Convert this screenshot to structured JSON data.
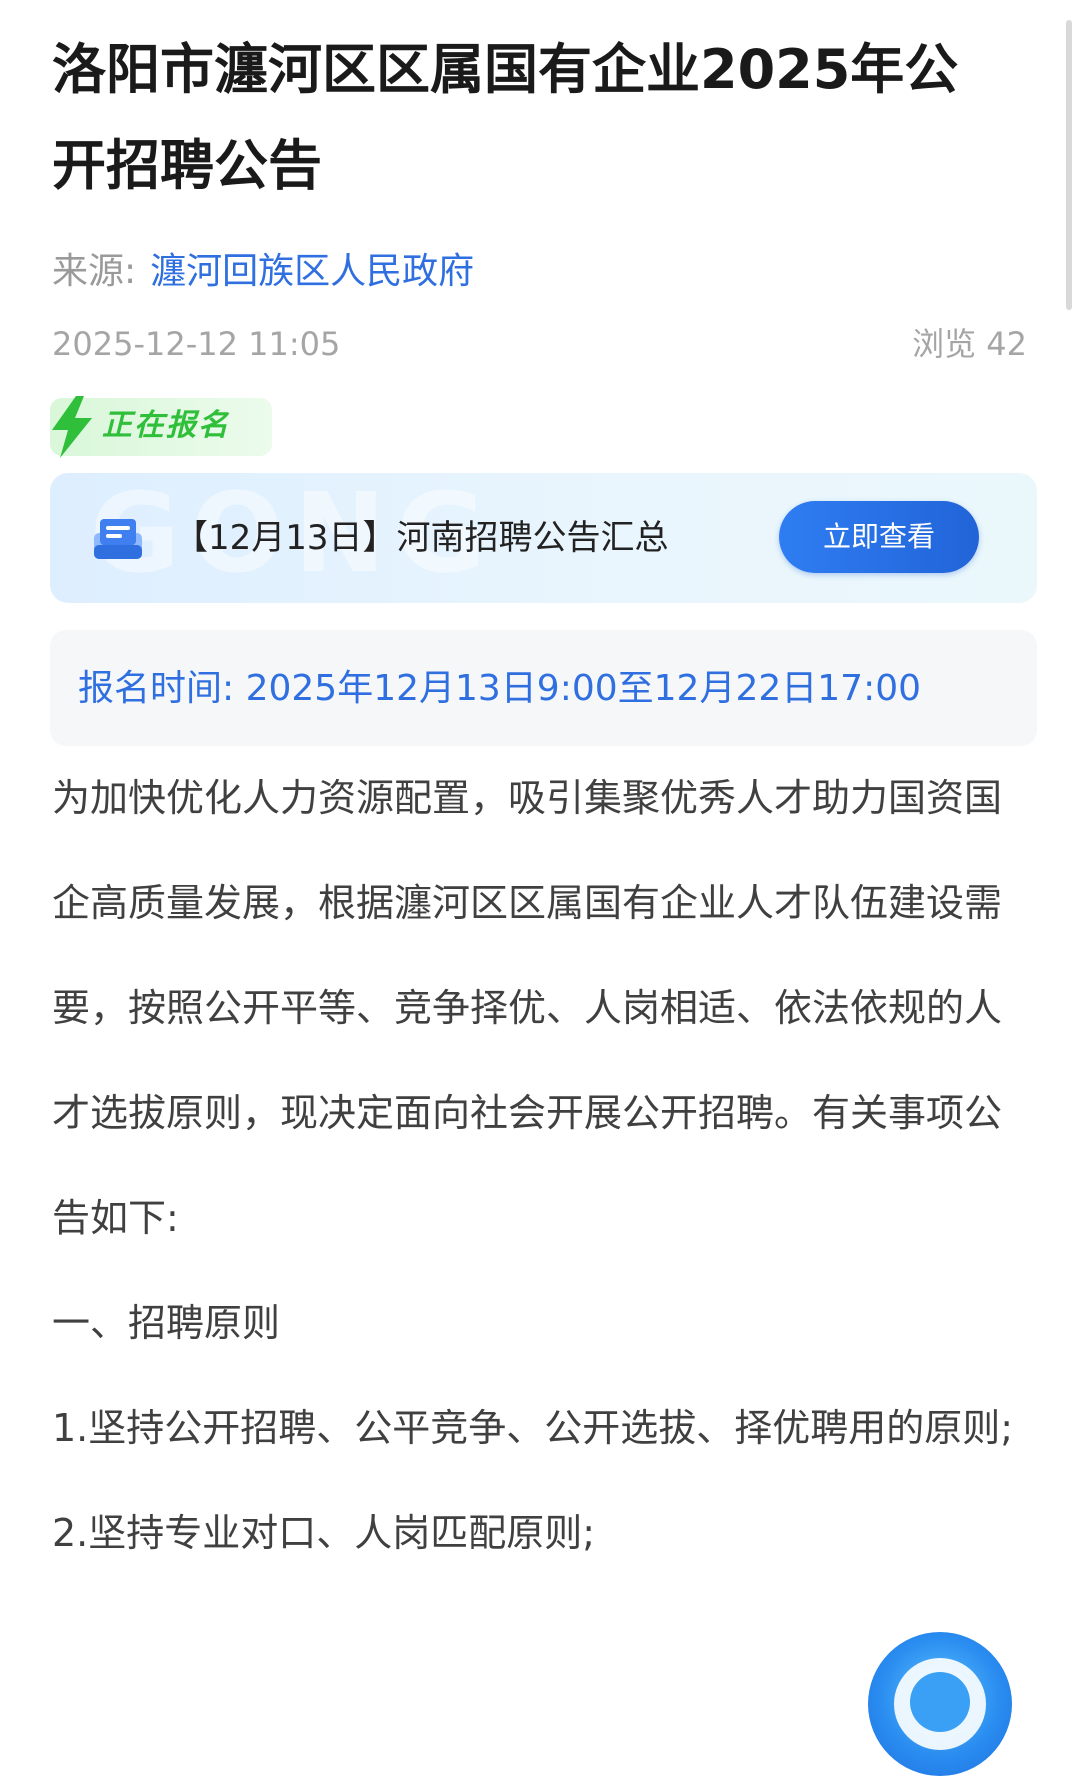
{
  "article": {
    "title": "洛阳市瀍河区区属国有企业2025年公开招聘公告",
    "source_label": "来源:",
    "source_name": "瀍河回族区人民政府",
    "date": "2025-12-12 11:05",
    "views": "浏览 42",
    "status_tag": "正在报名"
  },
  "promo": {
    "text": "【12月13日】河南招聘公告汇总",
    "button": "立即查看",
    "watermark": "GONG"
  },
  "registration": {
    "text": "报名时间: 2025年12月13日9:00至12月22日17:00"
  },
  "body": {
    "intro": "为加快优化人力资源配置，吸引集聚优秀人才助力国资国企高质量发展，根据瀍河区区属国有企业人才队伍建设需要，按照公开平等、竞争择优、人岗相适、依法依规的人才选拔原则，现决定面向社会开展公开招聘。有关事项公告如下:",
    "section_1_heading": "一、招聘原则",
    "principle_1": "1.坚持公开招聘、公平竞争、公开选拔、择优聘用的原则;",
    "principle_2": "2.坚持专业对口、人岗匹配原则;"
  },
  "icons": {
    "status": "lightning-bolt-icon",
    "promo": "document-icon",
    "fab": "assistant-icon"
  },
  "colors": {
    "link_blue": "#2f6fe0",
    "status_green": "#2fbf3a",
    "button_blue": "#2164d8"
  }
}
